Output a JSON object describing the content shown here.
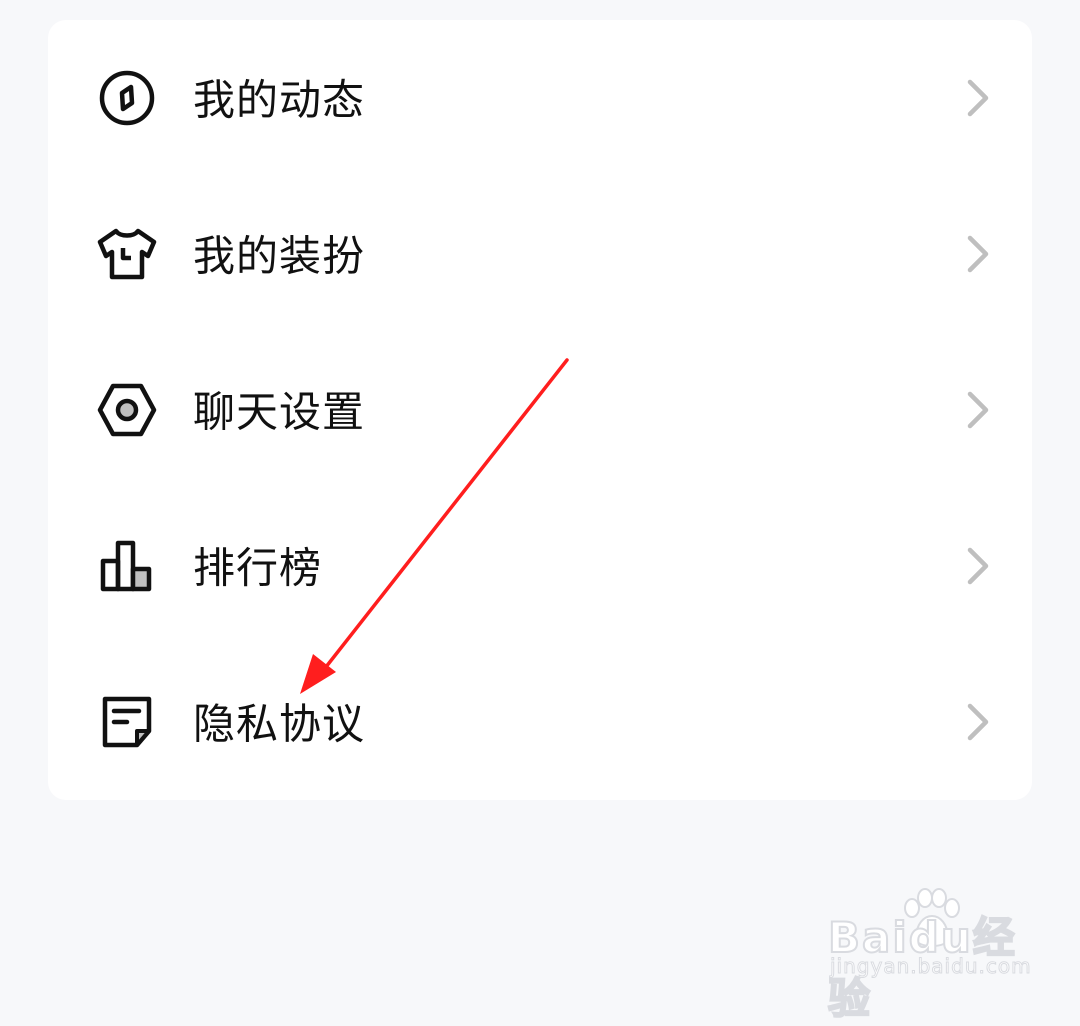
{
  "menu": {
    "items": [
      {
        "label": "我的动态",
        "icon": "compass-icon"
      },
      {
        "label": "我的装扮",
        "icon": "shirt-icon"
      },
      {
        "label": "聊天设置",
        "icon": "settings-hexagon-icon"
      },
      {
        "label": "排行榜",
        "icon": "bar-chart-icon"
      },
      {
        "label": "隐私协议",
        "icon": "document-icon"
      }
    ]
  },
  "colors": {
    "background": "#f7f8fa",
    "card": "#ffffff",
    "text": "#111111",
    "chevron": "#bfbfbf",
    "annotation_arrow": "#ff1e1e"
  },
  "watermark": {
    "brand": "Baidu经验",
    "url": "jingyan.baidu.com"
  }
}
